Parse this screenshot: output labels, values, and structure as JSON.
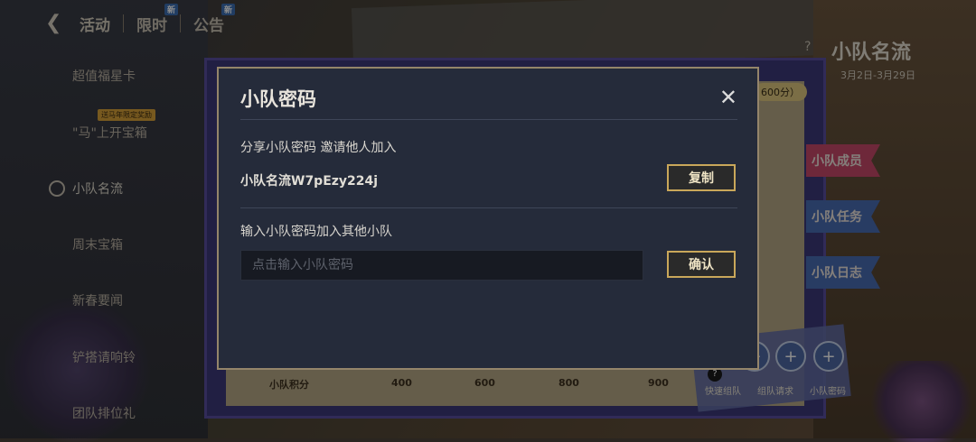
{
  "nav": {
    "tabs": [
      {
        "label": "活动",
        "badge": ""
      },
      {
        "label": "限时",
        "badge": "新"
      },
      {
        "label": "公告",
        "badge": "新"
      }
    ]
  },
  "sidebar": {
    "items": [
      {
        "label": "超值福星卡"
      },
      {
        "label": "\"马\"上开宝箱",
        "badge": "送马年限定奖励"
      },
      {
        "label": "小队名流"
      },
      {
        "label": "周末宝箱"
      },
      {
        "label": "新春要闻"
      },
      {
        "label": "铲搭请响铃"
      },
      {
        "label": "团队排位礼"
      }
    ]
  },
  "event": {
    "title": "小队名流",
    "date": "3月2日-3月29日",
    "help": "?"
  },
  "side_tabs": [
    {
      "label": "小队成员",
      "color": "#c94a6a"
    },
    {
      "label": "小队任务",
      "color": "#4a6db5"
    },
    {
      "label": "小队日志",
      "color": "#4a6db5"
    }
  ],
  "board": {
    "pill": "600分）",
    "score_label": "小队积分",
    "scores": [
      "400",
      "600",
      "800",
      "900"
    ],
    "actions": [
      {
        "label": "快速组队",
        "icon": "?"
      },
      {
        "label": "组队请求",
        "icon": "+"
      },
      {
        "label": "小队密码",
        "icon": "+"
      }
    ]
  },
  "dialog": {
    "title": "小队密码",
    "close_icon": "✕",
    "share_text": "分享小队密码  邀请他人加入",
    "code": "小队名流W7pEzy224j",
    "copy_label": "复制",
    "join_text": "输入小队密码加入其他小队",
    "input_placeholder": "点击输入小队密码",
    "input_value": "",
    "confirm_label": "确认"
  }
}
